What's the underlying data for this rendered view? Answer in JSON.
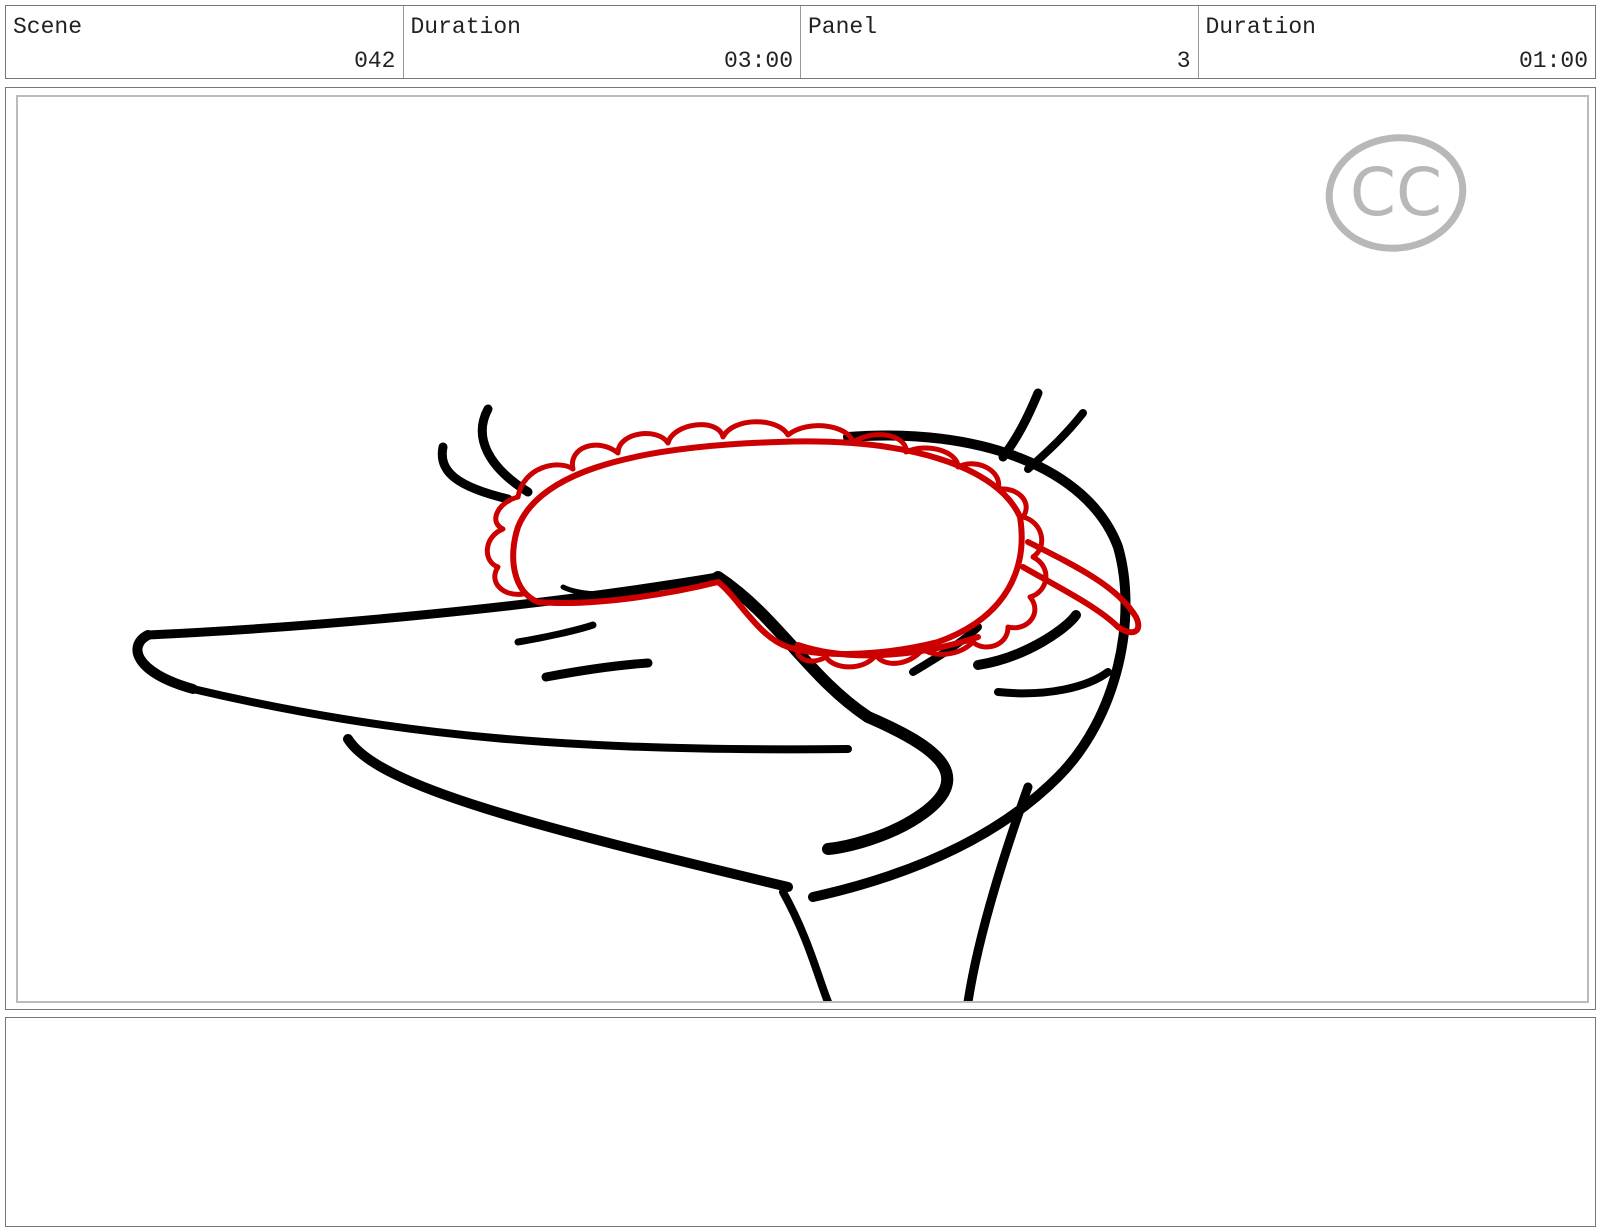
{
  "header": {
    "cells": [
      {
        "label": "Scene",
        "value": "042"
      },
      {
        "label": "Duration",
        "value": "03:00"
      },
      {
        "label": "Panel",
        "value": "3"
      },
      {
        "label": "Duration",
        "value": "01:00"
      }
    ]
  },
  "panel": {
    "watermark_text": "CC",
    "colors": {
      "ink": "#000000",
      "mask": "#cc0000",
      "watermark": "#b8b8b8",
      "frame_border": "#bbbbbb"
    }
  },
  "notes": {
    "text": ""
  }
}
